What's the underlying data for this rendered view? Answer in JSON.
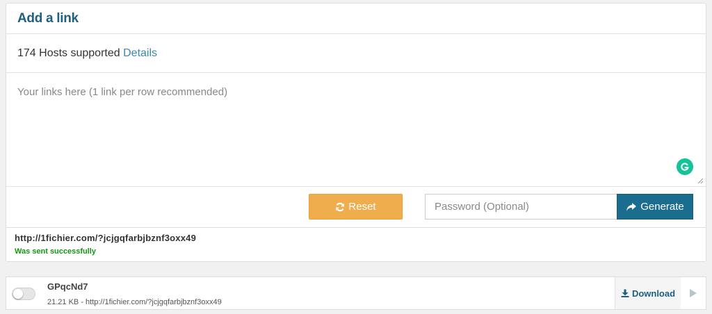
{
  "panel": {
    "title": "Add a link",
    "hosts_count_text": "174 Hosts supported",
    "details_link": "Details",
    "links_placeholder": "Your links here (1 link per row recommended)",
    "reset_label": "Reset",
    "password_placeholder": "Password (Optional)",
    "generate_label": "Generate"
  },
  "result": {
    "url": "http://1fichier.com/?jcjgqfarbjbznf3oxx49",
    "status": "Was sent successfully"
  },
  "file": {
    "name": "GPqcNd7",
    "meta": "21.21 KB - http://1fichier.com/?jcjgqfarbjbznf3oxx49",
    "download_label": "Download"
  },
  "icons": {
    "reset": "refresh-icon",
    "generate": "share-arrow-icon",
    "download": "download-icon",
    "play": "play-icon",
    "grammarly": "grammarly-icon"
  },
  "colors": {
    "title": "#1f5f7f",
    "link": "#3a87ad",
    "reset_button": "#f0ad4e",
    "generate_button": "#1b6d8f",
    "success": "#119911",
    "grammarly": "#15c39a"
  }
}
